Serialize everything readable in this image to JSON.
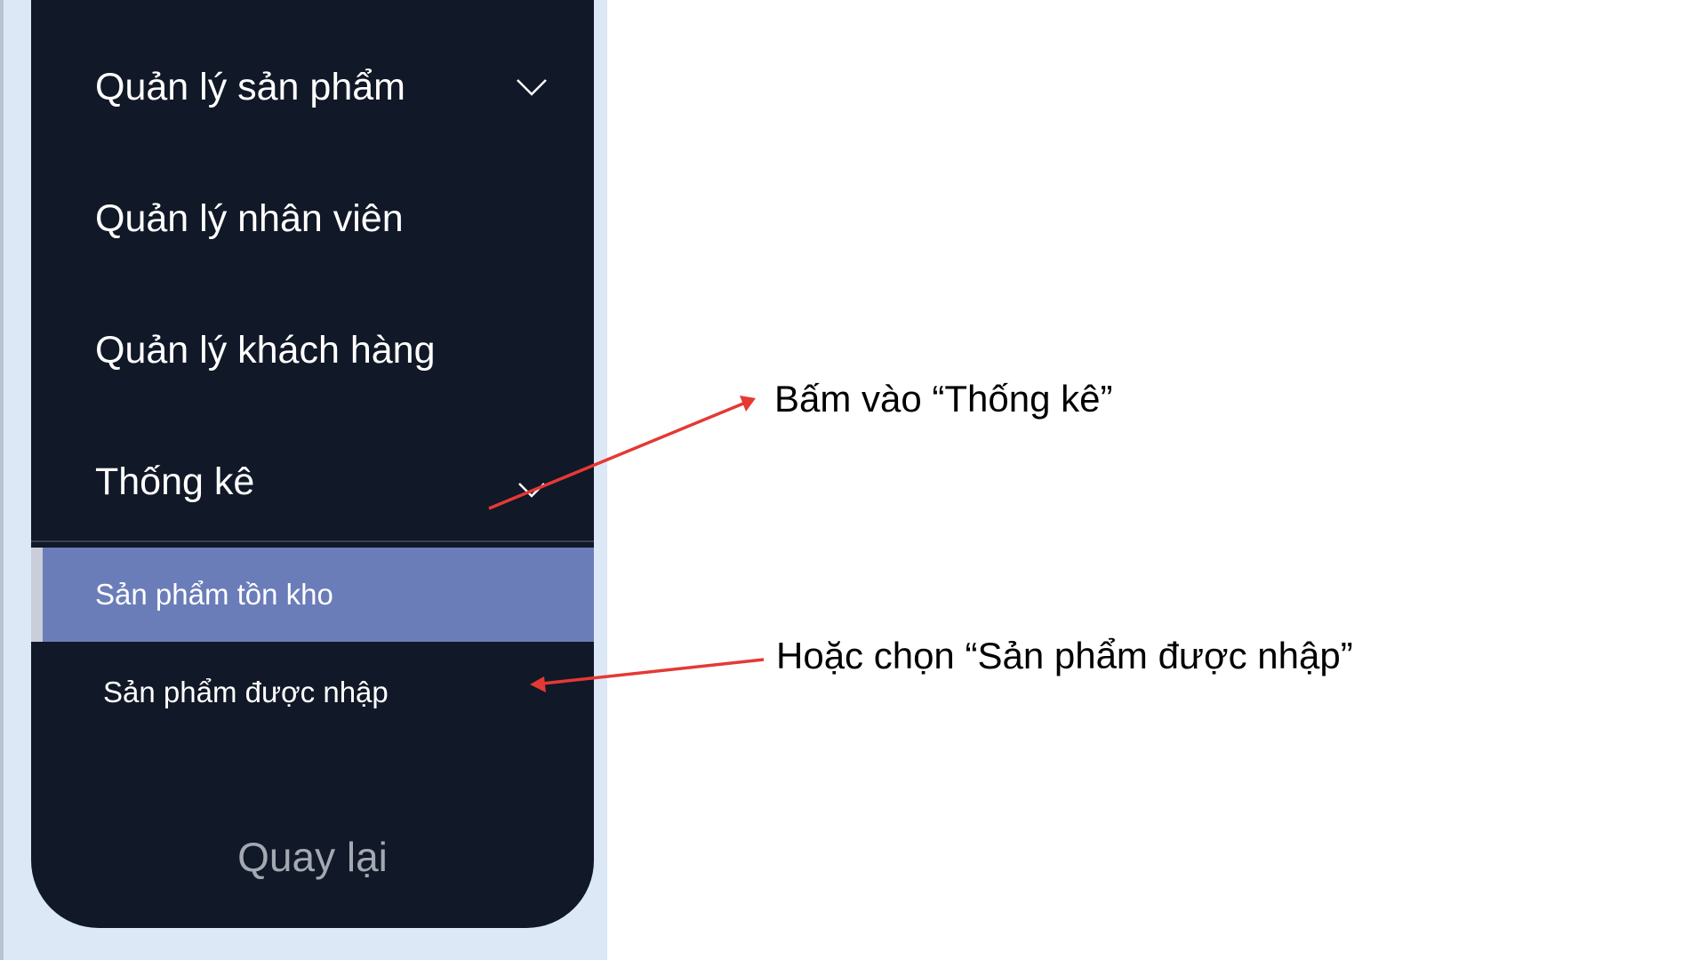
{
  "sidebar": {
    "items": [
      {
        "label": "Quản lý sản phẩm",
        "chevron": "chevron-down-icon"
      },
      {
        "label": "Quản lý nhân viên"
      },
      {
        "label": "Quản lý khách hàng"
      },
      {
        "label": "Thống kê",
        "chevron": "chevron-down-icon"
      }
    ],
    "submenu": [
      {
        "label": "Sản phẩm tồn kho",
        "active": true
      },
      {
        "label": "Sản phẩm được nhập",
        "active": false
      }
    ],
    "back_label": "Quay lại"
  },
  "annotations": {
    "note1": "Bấm vào “Thống kê”",
    "note2": "Hoặc chọn “Sản phẩm được nhập”"
  },
  "colors": {
    "sidebar_bg": "#111827",
    "active_bg": "#6a7db8",
    "app_bg": "#dde8f7",
    "arrow": "#e53935"
  }
}
